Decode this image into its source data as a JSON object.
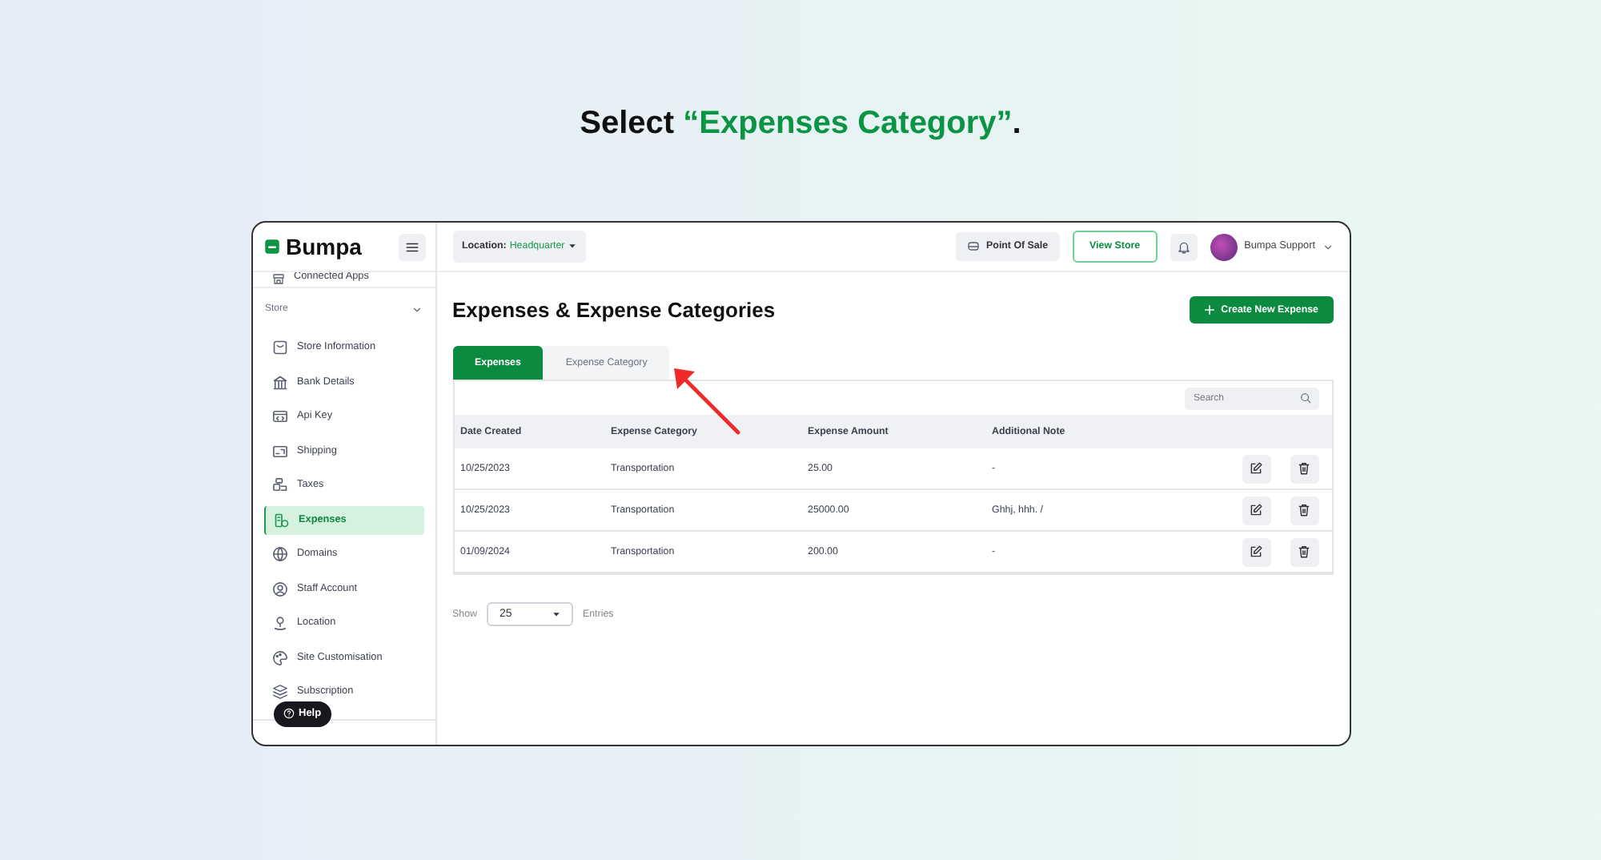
{
  "instruction": {
    "text": "Select ",
    "highlight": "“Expenses Category”",
    "end": "."
  },
  "brand": {
    "name": "Bumpa"
  },
  "location": {
    "label": "Location:",
    "value": "Headquarter"
  },
  "topbar": {
    "pos_button": "Point Of Sale",
    "view_store_button": "View Store",
    "user": "Bumpa Support"
  },
  "sidebar": {
    "partial_item": "Connected Apps",
    "section": {
      "label": "Store",
      "expanded": true
    },
    "items": [
      {
        "label": "Store Information",
        "selected": false
      },
      {
        "label": "Bank Details",
        "selected": false
      },
      {
        "label": "Api Key",
        "selected": false
      },
      {
        "label": "Shipping",
        "selected": false
      },
      {
        "label": "Taxes",
        "selected": false
      },
      {
        "label": "Expenses",
        "selected": true
      },
      {
        "label": "Domains",
        "selected": false
      },
      {
        "label": "Staff Account",
        "selected": false
      },
      {
        "label": "Location",
        "selected": false
      },
      {
        "label": "Site Customisation",
        "selected": false
      },
      {
        "label": "Subscription",
        "selected": false
      }
    ]
  },
  "help_button": "Help",
  "page": {
    "title": "Expenses & Expense Categories",
    "create_button": "Create New Expense",
    "tabs": [
      {
        "label": "Expenses",
        "selected": true
      },
      {
        "label": "Expense Category",
        "selected": false
      }
    ],
    "search": {
      "placeholder": "Search"
    },
    "table": {
      "columns": [
        "Date Created",
        "Expense Category",
        "Expense Amount",
        "Additional Note"
      ],
      "rows": [
        [
          "10/25/2023",
          "Transportation",
          "25.00",
          "-"
        ],
        [
          "10/25/2023",
          "Transportation",
          "25000.00",
          "Ghhj, hhh. /"
        ],
        [
          "01/09/2024",
          "Transportation",
          "200.00",
          "-"
        ]
      ]
    },
    "pagination": {
      "show": "Show",
      "value": "25",
      "entries": "Entries"
    }
  }
}
